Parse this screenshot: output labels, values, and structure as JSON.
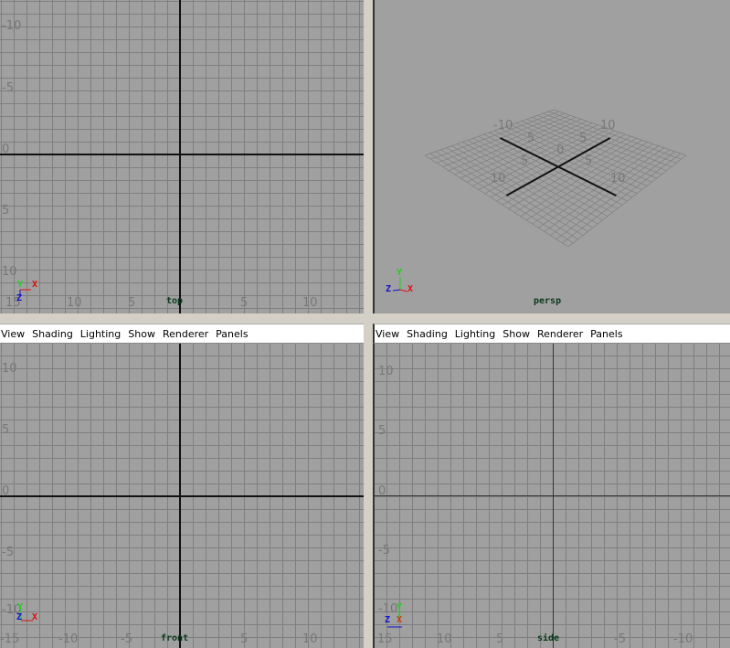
{
  "menus": [
    "View",
    "Shading",
    "Lighting",
    "Show",
    "Renderer",
    "Panels"
  ],
  "views": {
    "top": {
      "camera": "top",
      "h_ticks": [
        "15",
        "10",
        "5",
        "5",
        "10"
      ],
      "v_ticks": [
        "-10",
        "-5",
        "0",
        "5",
        "10"
      ]
    },
    "persp": {
      "camera": "persp",
      "grid_labels": [
        "-10",
        "10",
        "5",
        "5",
        "0",
        "5",
        "5",
        "10",
        "10"
      ]
    },
    "front": {
      "camera": "front",
      "h_ticks": [
        "-15",
        "-10",
        "-5",
        "5",
        "10"
      ],
      "v_ticks": [
        "10",
        "5",
        "0",
        "-5",
        "-10"
      ]
    },
    "side": {
      "camera": "side",
      "h_ticks": [
        "15",
        "10",
        "5",
        "-5",
        "-10"
      ],
      "v_ticks": [
        "10",
        "5",
        "0",
        "-5",
        "-10"
      ]
    }
  },
  "axis_gizmo": {
    "x": "X",
    "y": "Y",
    "z": "Z",
    "colors": {
      "x": "#e01010",
      "y": "#20d020",
      "z": "#1010d0"
    }
  },
  "colors": {
    "viewport_bg": "#a0a0a0",
    "grid": "#7f7f7f",
    "axis": "#111111"
  }
}
